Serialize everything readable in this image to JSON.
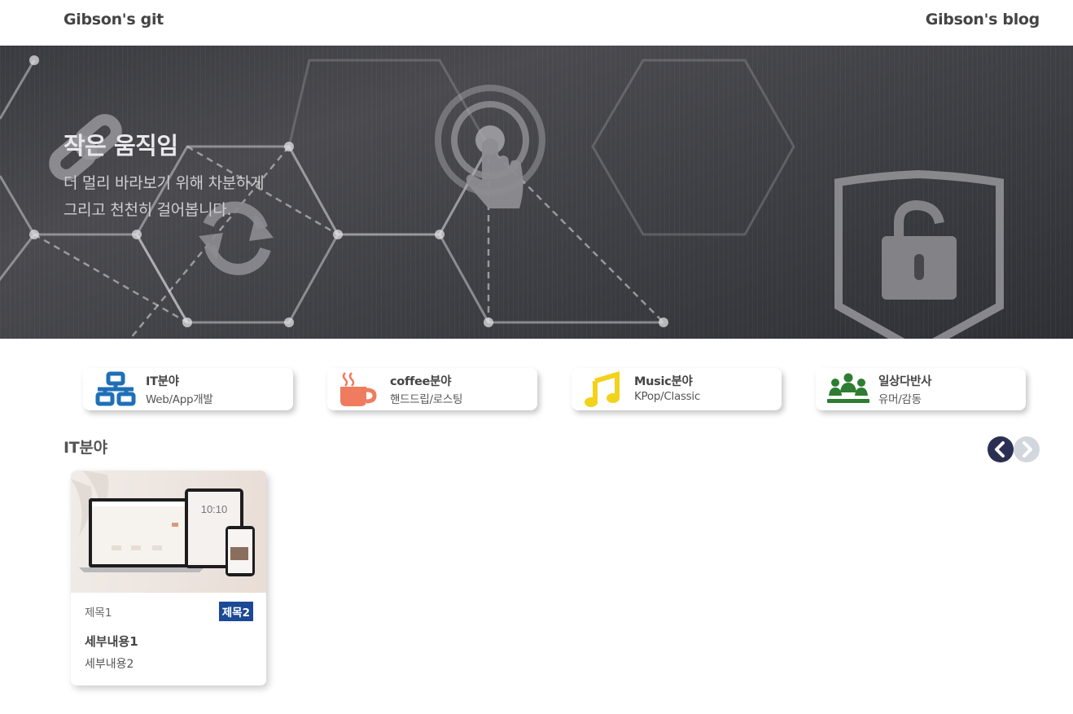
{
  "header": {
    "left_link": "Gibson's git",
    "right_link": "Gibson's blog"
  },
  "hero": {
    "title": "작은 움직임",
    "subtitle_line1": "더 멀리 바라보기 위해 차분하게",
    "subtitle_line2": "그리고 천천히 걸어봅니다."
  },
  "categories": [
    {
      "title": "IT분야",
      "subtitle": "Web/App개발",
      "icon": "network-icon",
      "color": "#1f6fb8"
    },
    {
      "title": "coffee분야",
      "subtitle": "핸드드립/로스팅",
      "icon": "coffee-cup-icon",
      "color": "#f07c5f"
    },
    {
      "title": "Music분야",
      "subtitle": "KPop/Classic",
      "icon": "music-note-icon",
      "color": "#f2d21b"
    },
    {
      "title": "일상다반사",
      "subtitle": "유머/감동",
      "icon": "people-group-icon",
      "color": "#2e7d32"
    }
  ],
  "section": {
    "title": "IT분야",
    "prev_icon": "chevron-left-icon",
    "next_icon": "chevron-right-icon"
  },
  "posts": [
    {
      "meta1": "제목1",
      "meta2": "제목2",
      "title": "세부내용1",
      "description": "세부내용2",
      "thumbnail_clock": "10:10"
    }
  ],
  "colors": {
    "nav_prev": "#2b2f52",
    "nav_next": "#d2d7dd",
    "badge": "#1c4996"
  }
}
